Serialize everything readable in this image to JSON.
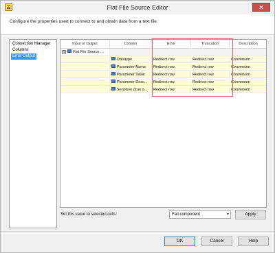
{
  "window": {
    "title": "Flat File Source Editor",
    "close_glyph": "✕"
  },
  "header": {
    "description": "Configure the properties used to connect to and obtain data from a text file."
  },
  "nav": {
    "items": [
      {
        "label": "Connection Manager"
      },
      {
        "label": "Columns"
      },
      {
        "label": "Error Output"
      }
    ],
    "selected": "Error Output"
  },
  "grid": {
    "headers": [
      "Input or Output",
      "Column",
      "Error",
      "Truncation",
      "Description"
    ],
    "group_row": {
      "toggle": "⊟",
      "label": "Flat File Source ..."
    },
    "rows": [
      {
        "column": "Datatype",
        "error": "Redirect row",
        "truncation": "Redirect row",
        "description": "Conversion"
      },
      {
        "column": "Parameter Name",
        "error": "Redirect row",
        "truncation": "Redirect row",
        "description": "Conversion"
      },
      {
        "column": "Parameter Value",
        "error": "Redirect row",
        "truncation": "Redirect row",
        "description": "Conversion"
      },
      {
        "column": "Parameter Desc...",
        "error": "Redirect row",
        "truncation": "Redirect row",
        "description": "Conversion"
      },
      {
        "column": "Sensitive (true o...",
        "error": "Redirect row",
        "truncation": "Redirect row",
        "description": "Conversion"
      }
    ]
  },
  "set_value": {
    "label": "Set this value to selected cells:",
    "selected_option": "Fail component",
    "apply_label": "Apply"
  },
  "footer": {
    "ok_label": "OK",
    "cancel_label": "Cancel",
    "help_label": "Help"
  },
  "colors": {
    "highlight": "#e05a66",
    "selection": "#3399ff",
    "row_bg": "#fefcd8",
    "close": "#c7504f"
  },
  "icons": {
    "app": "flat-file-icon",
    "row": "column-icon"
  }
}
